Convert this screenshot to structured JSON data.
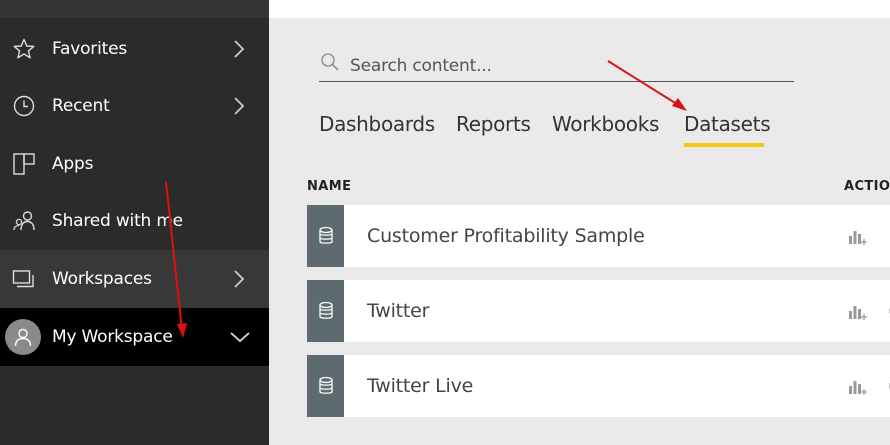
{
  "sidebar": {
    "items": [
      {
        "label": "Favorites",
        "icon": "star-icon"
      },
      {
        "label": "Recent",
        "icon": "clock-icon"
      },
      {
        "label": "Apps",
        "icon": "apps-icon"
      },
      {
        "label": "Shared with me",
        "icon": "shared-people-icon"
      },
      {
        "label": "Workspaces",
        "icon": "workspaces-icon"
      },
      {
        "label": "My Workspace",
        "icon": "avatar-icon"
      }
    ]
  },
  "search": {
    "placeholder": "Search content..."
  },
  "tabs": [
    {
      "label": "Dashboards"
    },
    {
      "label": "Reports"
    },
    {
      "label": "Workbooks"
    },
    {
      "label": "Datasets",
      "active": true
    }
  ],
  "table": {
    "headers": {
      "name": "NAME",
      "actions": "ACTIONS"
    },
    "rows": [
      {
        "name": "Customer Profitability Sample",
        "icon": "database-icon"
      },
      {
        "name": "Twitter",
        "icon": "database-icon"
      },
      {
        "name": "Twitter Live",
        "icon": "database-icon"
      }
    ]
  },
  "colors": {
    "sidebar_bg": "#2b2b2b",
    "sidebar_selected": "#000000",
    "tab_underline": "#f2c811",
    "row_side": "#5d6a6f",
    "annotation_arrow": "#dd1111"
  }
}
